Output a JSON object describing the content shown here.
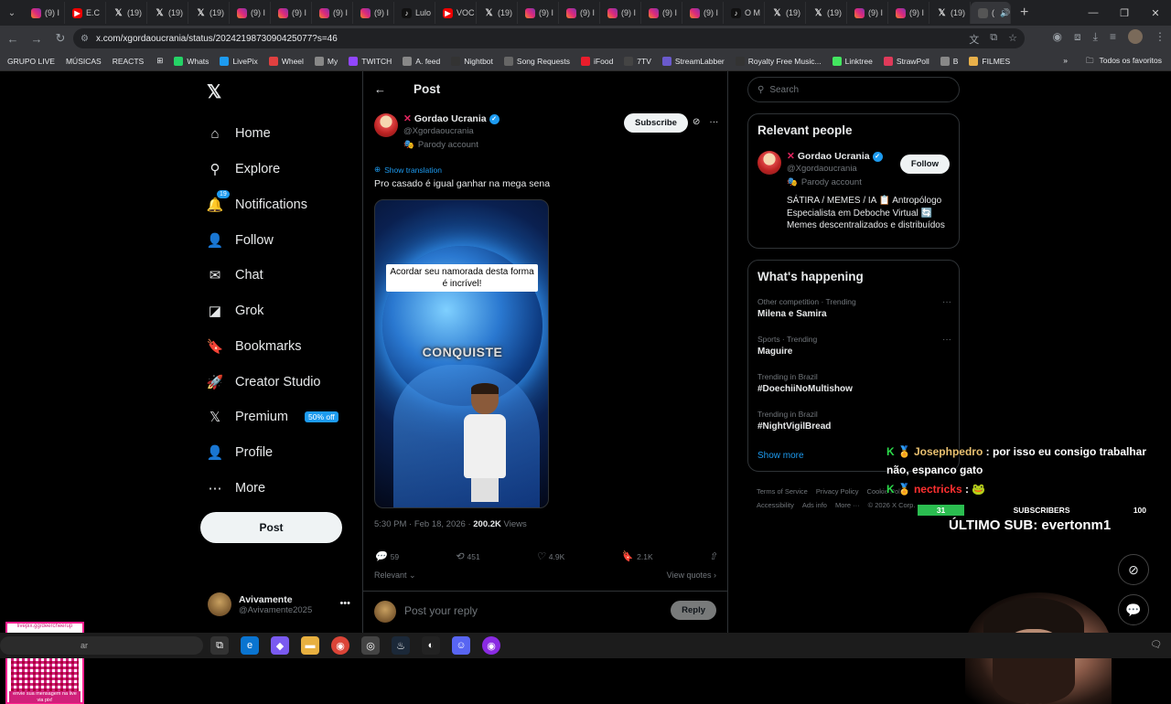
{
  "browser": {
    "tabs": [
      {
        "icon": "instagram-icon",
        "label": "(9) I"
      },
      {
        "icon": "youtube-icon",
        "label": "E.C"
      },
      {
        "icon": "x-icon",
        "label": "(19)"
      },
      {
        "icon": "x-icon",
        "label": "(19)"
      },
      {
        "icon": "x-icon",
        "label": "(19)"
      },
      {
        "icon": "instagram-icon",
        "label": "(9) I"
      },
      {
        "icon": "instagram-icon",
        "label": "(9) I"
      },
      {
        "icon": "instagram-icon",
        "label": "(9) I"
      },
      {
        "icon": "instagram-icon",
        "label": "(9) I"
      },
      {
        "icon": "tiktok-icon",
        "label": "Lulo"
      },
      {
        "icon": "youtube-icon",
        "label": "VOC"
      },
      {
        "icon": "x-icon",
        "label": "(19)"
      },
      {
        "icon": "instagram-icon",
        "label": "(9) I"
      },
      {
        "icon": "instagram-icon",
        "label": "(9) I"
      },
      {
        "icon": "instagram-icon",
        "label": "(9) I"
      },
      {
        "icon": "instagram-icon",
        "label": "(9) I"
      },
      {
        "icon": "instagram-icon",
        "label": "(9) I"
      },
      {
        "icon": "tiktok-icon",
        "label": "O M"
      },
      {
        "icon": "x-icon",
        "label": "(19)"
      },
      {
        "icon": "x-icon",
        "label": "(19)"
      },
      {
        "icon": "instagram-icon",
        "label": "(9) I"
      },
      {
        "icon": "instagram-icon",
        "label": "(9) I"
      },
      {
        "icon": "x-icon",
        "label": "(19)"
      }
    ],
    "active_tab_label": "(",
    "url": "x.com/xgordaoucrania/status/2024219873090425077?s=46",
    "bookmarks": [
      {
        "label": "GRUPO LIVE",
        "color": ""
      },
      {
        "label": "MÚSICAS",
        "color": ""
      },
      {
        "label": "REACTS",
        "color": ""
      },
      {
        "label": "Whats",
        "color": "#25d366"
      },
      {
        "label": "LivePix",
        "color": "#1d9bf0"
      },
      {
        "label": "Wheel",
        "color": "#e04040"
      },
      {
        "label": "My",
        "color": "#888"
      },
      {
        "label": "TWITCH",
        "color": "#9146ff"
      },
      {
        "label": "A. feed",
        "color": "#888"
      },
      {
        "label": "Nightbot",
        "color": "#333"
      },
      {
        "label": "Song Requests",
        "color": "#666"
      },
      {
        "label": "iFood",
        "color": "#ea1d2c"
      },
      {
        "label": "7TV",
        "color": "#444"
      },
      {
        "label": "StreamLabber",
        "color": "#6a5acd"
      },
      {
        "label": "Royalty Free Music...",
        "color": "#333"
      },
      {
        "label": "Linktree",
        "color": "#43e660"
      },
      {
        "label": "StrawPoll",
        "color": "#e03a5a"
      },
      {
        "label": "B",
        "color": "#888"
      },
      {
        "label": "FILMES",
        "color": "#e8b04a"
      }
    ],
    "all_bookmarks": "Todos os favoritos"
  },
  "sidebar": {
    "items": [
      {
        "label": "Home",
        "icon": "home-icon",
        "glyph": "⌂"
      },
      {
        "label": "Explore",
        "icon": "search-icon",
        "glyph": "⚲"
      },
      {
        "label": "Notifications",
        "icon": "bell-icon",
        "glyph": "🔔"
      },
      {
        "label": "Follow",
        "icon": "follow-icon",
        "glyph": "👤"
      },
      {
        "label": "Chat",
        "icon": "mail-icon",
        "glyph": "✉"
      },
      {
        "label": "Grok",
        "icon": "grok-icon",
        "glyph": "◪"
      },
      {
        "label": "Bookmarks",
        "icon": "bookmark-icon",
        "glyph": "🔖"
      },
      {
        "label": "Creator Studio",
        "icon": "rocket-icon",
        "glyph": "🚀"
      },
      {
        "label": "Premium",
        "icon": "x-premium-icon",
        "glyph": "𝕏"
      },
      {
        "label": "Profile",
        "icon": "profile-icon",
        "glyph": "👤"
      },
      {
        "label": "More",
        "icon": "more-circle-icon",
        "glyph": "⋯"
      }
    ],
    "notification_badge": "19",
    "premium_tag": "50% off",
    "post_button": "Post",
    "account": {
      "name": "Avivamente",
      "handle": "@Avivamente2025"
    }
  },
  "post": {
    "header_title": "Post",
    "author_name": "Gordao Ucrania",
    "author_handle": "@Xgordaoucrania",
    "parody_label": "Parody account",
    "subscribe": "Subscribe",
    "show_translation": "Show translation",
    "text": "Pro casado é igual ganhar na mega sena",
    "media_caption": "Acordar seu namorada desta forma é incrível!",
    "media_overlay": "CONQUISTE",
    "time": "5:30 PM · Feb 18, 2026 · ",
    "views_count": "200.2K",
    "views_label": " Views",
    "replies": "59",
    "reposts": "451",
    "likes": "4.9K",
    "bookmarks": "2.1K",
    "relevant": "Relevant ⌄",
    "view_quotes": "View quotes ›",
    "reply_placeholder": "Post your reply",
    "reply_button": "Reply"
  },
  "right": {
    "search_placeholder": "Search",
    "relevant_people_title": "Relevant people",
    "person": {
      "name": "Gordao Ucrania",
      "handle": "@Xgordaoucrania",
      "parody": "Parody account",
      "follow": "Follow",
      "bio": "SÁTIRA / MEMES / IA 📋 Antropólogo Especialista em Deboche Virtual 🔄 Memes descentralizados e distribuídos"
    },
    "happening_title": "What's happening",
    "trends": [
      {
        "category": "Other competition · Trending",
        "title": "Milena e Samira"
      },
      {
        "category": "Sports · Trending",
        "title": "Maguire"
      },
      {
        "category": "Trending in Brazil",
        "title": "#DoechiiNoMultishow"
      },
      {
        "category": "Trending in Brazil",
        "title": "#NightVigilBread"
      }
    ],
    "show_more": "Show more",
    "footer": [
      "Terms of Service",
      "Privacy Policy",
      "Cookie Policy",
      "Accessibility",
      "Ads info",
      "More ···",
      "© 2026 X Corp."
    ]
  },
  "overlay": {
    "chat": [
      {
        "user": "Josephpedro",
        "message": ": por isso eu consigo trabalhar não, espanco gato"
      },
      {
        "user": "nectricks",
        "message": ": 🐸"
      }
    ],
    "sub_current": "31",
    "sub_label": "SUBSCRIBERS",
    "sub_goal": "100",
    "sub_fraction": 0.31,
    "last_sub": "ÚLTIMO SUB: evertonm1",
    "qr_top": "livepix.gg/deercheerup",
    "qr_bottom": "envie sua mensagem na live via pix!"
  },
  "taskbar": {
    "search": "ar"
  }
}
